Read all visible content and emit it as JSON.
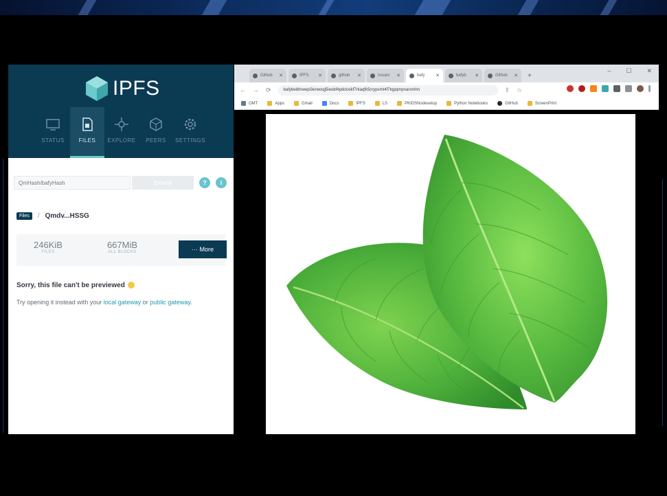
{
  "ipfs": {
    "logo_text": "IPFS",
    "nav": [
      {
        "label": "STATUS",
        "icon": "status-icon",
        "active": false
      },
      {
        "label": "FILES",
        "icon": "files-icon",
        "active": true
      },
      {
        "label": "EXPLORE",
        "icon": "explore-icon",
        "active": false
      },
      {
        "label": "PEERS",
        "icon": "peers-icon",
        "active": false
      },
      {
        "label": "SETTINGS",
        "icon": "settings-icon",
        "active": false
      }
    ],
    "search_placeholder": "QmHash/bafyHash",
    "browse_label": "Browse",
    "breadcrumb": {
      "root": "Files",
      "separator": "/",
      "cid": "Qmdv...HSSG"
    },
    "stats": {
      "files_value": "246KiB",
      "files_label": "FILES",
      "blocks_value": "667MiB",
      "blocks_label": "ALL BLOCKS"
    },
    "more_label": "··· More",
    "message_title": "Sorry, this file can't be previewed",
    "message_prefix": "Try opening it instead with your ",
    "message_link1": "local gateway",
    "message_or": " or ",
    "message_link2": "public gateway",
    "message_suffix": "."
  },
  "browser": {
    "tabs": [
      "Github",
      "IPFS",
      "github",
      "Issues",
      "bafy",
      "bafyb",
      "Github"
    ],
    "active_tab": 4,
    "address": "bafybeibhwwpi3enwxqj5ieobf4pdckxikf7rkaqfk5crypvmt4f7tqpqmpnarxmhn",
    "bookmarks": [
      "OMT",
      "Apps",
      "Gmail",
      "Docs",
      "IPFS",
      "LS",
      "PKIDSNodesetup",
      "Python Notebooks",
      "GitHub",
      "ScreenPrint"
    ],
    "window_controls": [
      "–",
      "☐",
      "✕"
    ]
  },
  "colors": {
    "ipfs_header": "#0b3a53",
    "ipfs_accent": "#6ac9c9",
    "leaf_green": "#4caf3a"
  }
}
